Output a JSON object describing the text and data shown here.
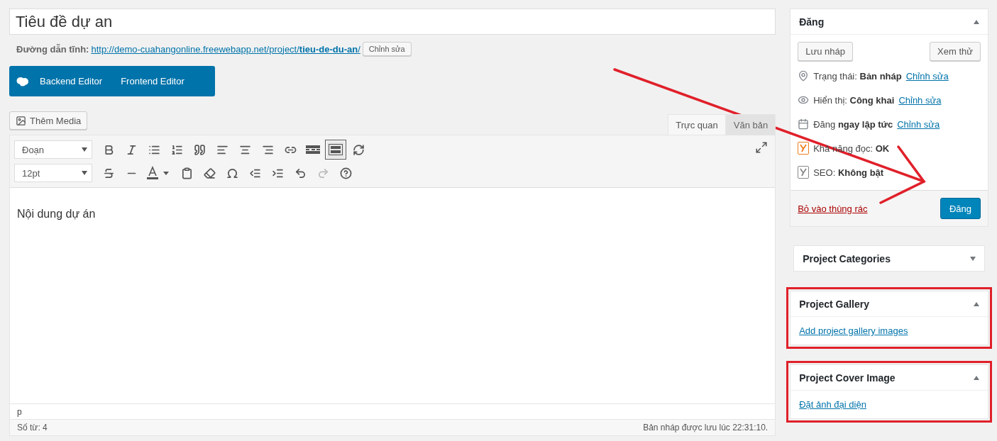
{
  "title_field": {
    "value": "Tiêu đề dự an"
  },
  "permalink": {
    "label": "Đường dẫn tĩnh:",
    "url": "http://demo-cuahangonline.freewebapp.net/project/**tieu-de-du-an**/",
    "edit_button": "Chỉnh sửa"
  },
  "builder_buttons": [
    "Backend Editor",
    "Frontend Editor"
  ],
  "add_media_button": "Thêm Media",
  "editor_tabs": [
    {
      "label": "Trực quan",
      "selected": true
    },
    {
      "label": "Văn bản",
      "selected": false
    }
  ],
  "toolbar": {
    "format_select": "Đoạn",
    "size_select": "12pt",
    "toolbar_toggle_pressed": true
  },
  "content": "Nội dung dự án",
  "path": "p",
  "word_count": "Số từ: 4",
  "save_status": "Bản nháp được lưu lúc 22:31:10.",
  "publish_box": {
    "title": "Đăng",
    "expanded": true,
    "save_draft": "Lưu nháp",
    "preview": "Xem thử",
    "rows": [
      {
        "kind": "status",
        "label": "Trạng thái:",
        "value": "Bản nháp",
        "link": "Chỉnh sửa"
      },
      {
        "kind": "visibility",
        "label": "Hiển thị:",
        "value": "Công khai",
        "link": "Chỉnh sửa"
      },
      {
        "kind": "schedule",
        "label": "Đăng",
        "value": "ngay lập tức",
        "link": "Chỉnh sửa"
      },
      {
        "kind": "readability",
        "label": "Khả năng đọc:",
        "value": "OK",
        "color": "#ee7c1b"
      },
      {
        "kind": "seo",
        "label": "SEO:",
        "value": "Không bật",
        "color": "#888888"
      }
    ],
    "trash_link": "Bỏ vào thùng rác",
    "publish_button": "Đăng"
  },
  "side_boxes": [
    {
      "title": "Project Categories",
      "expanded": false,
      "highlighted": false
    },
    {
      "title": "Project Gallery",
      "expanded": true,
      "highlighted": true,
      "link": "Add project gallery images"
    },
    {
      "title": "Project Cover Image",
      "expanded": true,
      "highlighted": true,
      "link": "Đặt ảnh đại diện"
    }
  ]
}
